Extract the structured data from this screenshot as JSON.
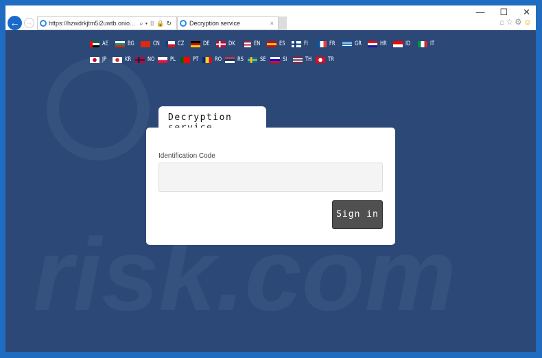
{
  "browser": {
    "url": "https://hzwdrkjtm5i2uwtb.onio...",
    "tab_title": "Decryption service",
    "window_controls": {
      "minimize": "—",
      "maximize": "☐",
      "close": "✕"
    }
  },
  "flags_row1": [
    {
      "code": "AE",
      "colors": [
        "#00732f",
        "#ffffff",
        "#000000"
      ],
      "side": "#ff0000"
    },
    {
      "code": "BG",
      "colors": [
        "#ffffff",
        "#00966e",
        "#d62612"
      ]
    },
    {
      "code": "CN",
      "colors": [
        "#de2910",
        "#de2910"
      ]
    },
    {
      "code": "CZ",
      "colors": [
        "#ffffff",
        "#d7141a"
      ],
      "side": "#11457e"
    },
    {
      "code": "DE",
      "colors": [
        "#000000",
        "#dd0000",
        "#ffce00"
      ]
    },
    {
      "code": "DK",
      "colors": [
        "#c60c30",
        "#c60c30"
      ],
      "cross": "#ffffff"
    },
    {
      "code": "EN",
      "colors": [
        "#b22234",
        "#ffffff",
        "#b22234",
        "#ffffff"
      ],
      "side": "#3c3b6e"
    },
    {
      "code": "ES",
      "colors": [
        "#c60b1e",
        "#ffc400",
        "#c60b1e"
      ]
    },
    {
      "code": "FI",
      "colors": [
        "#ffffff",
        "#ffffff"
      ],
      "cross": "#003580"
    },
    {
      "code": "FR",
      "vert": [
        "#0055a4",
        "#ffffff",
        "#ef4135"
      ]
    },
    {
      "code": "GR",
      "colors": [
        "#0d5eaf",
        "#ffffff",
        "#0d5eaf",
        "#ffffff",
        "#0d5eaf"
      ]
    },
    {
      "code": "HR",
      "colors": [
        "#ff0000",
        "#ffffff",
        "#171796"
      ]
    },
    {
      "code": "ID",
      "colors": [
        "#ff0000",
        "#ffffff"
      ]
    },
    {
      "code": "IT",
      "vert": [
        "#009246",
        "#ffffff",
        "#ce2b37"
      ]
    }
  ],
  "flags_row2": [
    {
      "code": "JP",
      "colors": [
        "#ffffff",
        "#ffffff"
      ],
      "dot": "#bc002d"
    },
    {
      "code": "KR",
      "colors": [
        "#ffffff",
        "#ffffff"
      ],
      "dot": "#cd2e3a"
    },
    {
      "code": "NO",
      "colors": [
        "#ba0c2f",
        "#ba0c2f"
      ],
      "cross": "#00205b"
    },
    {
      "code": "PL",
      "colors": [
        "#ffffff",
        "#dc143c"
      ]
    },
    {
      "code": "PT",
      "vert": [
        "#006600",
        "#ff0000",
        "#ff0000"
      ]
    },
    {
      "code": "RO",
      "vert": [
        "#002b7f",
        "#fcd116",
        "#ce1126"
      ]
    },
    {
      "code": "RS",
      "colors": [
        "#c6363c",
        "#0c4076",
        "#ffffff"
      ]
    },
    {
      "code": "SE",
      "colors": [
        "#006aa7",
        "#006aa7"
      ],
      "cross": "#fecc00"
    },
    {
      "code": "SI",
      "colors": [
        "#ffffff",
        "#0000ff",
        "#ff0000"
      ]
    },
    {
      "code": "TH",
      "colors": [
        "#a51931",
        "#ffffff",
        "#2d2a4a",
        "#ffffff",
        "#a51931"
      ]
    },
    {
      "code": "TR",
      "colors": [
        "#e30a17",
        "#e30a17"
      ],
      "dot": "#ffffff"
    }
  ],
  "form": {
    "tab_title": "Decryption service",
    "id_label": "Identification Code",
    "id_value": "",
    "sign_in": "Sign in"
  },
  "watermark": "risk.com"
}
